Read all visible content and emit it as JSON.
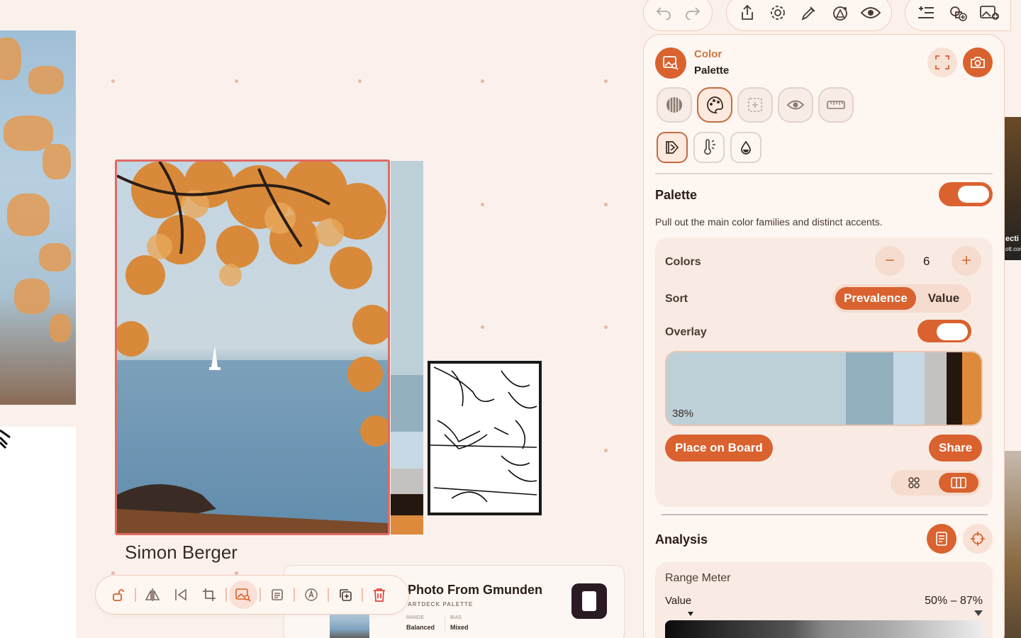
{
  "canvas": {
    "photo_caption": "Simon Berger",
    "card": {
      "title": "Photo From Gmunden",
      "subtitle": "ARTDECK PALETTE",
      "range_label": "RANGE",
      "range_value": "Balanced",
      "bias_label": "BIAS",
      "bias_value": "Mixed"
    },
    "palette_strip_colors": [
      "#bdd0d8",
      "#93b0be",
      "#c6d9e4",
      "#c4c2c1",
      "#24170f",
      "#dd8a3c"
    ],
    "right_edge_text": [
      "ecti",
      "ott.cor"
    ],
    "bottom_toolbar_icons": [
      "unlock-icon",
      "flip-icon",
      "align-icon",
      "crop-icon",
      "image-search-icon",
      "notes-icon",
      "edit-icon",
      "duplicate-icon",
      "trash-icon"
    ]
  },
  "top_toolbar": {
    "group1": [
      "undo-icon",
      "redo-icon"
    ],
    "group2": [
      "share-icon",
      "gear-icon",
      "eyedropper-icon",
      "shapes-icon",
      "eye-icon"
    ],
    "group3": [
      "list-add-icon",
      "group-add-icon",
      "image-add-icon"
    ]
  },
  "panel": {
    "header": {
      "title_line1": "Color",
      "title_line2": "Palette"
    },
    "modes": [
      "halftone-icon",
      "palette-icon",
      "focus-icon",
      "eye-icon",
      "ruler-icon"
    ],
    "submodes": [
      "marker-icon",
      "temperature-icon",
      "drop-icon"
    ],
    "palette": {
      "title": "Palette",
      "enabled": true,
      "description": "Pull out the main color families and distinct accents.",
      "colors_label": "Colors",
      "colors_value": "6",
      "minus": "−",
      "plus": "+",
      "sort_label": "Sort",
      "sort_options": [
        "Prevalence",
        "Value"
      ],
      "sort_selected": "Prevalence",
      "overlay_label": "Overlay",
      "overlay_enabled": true,
      "swatches": [
        {
          "color": "#bdd0d8",
          "share": 0.57
        },
        {
          "color": "#93b0be",
          "share": 0.15
        },
        {
          "color": "#c6d9e4",
          "share": 0.1
        },
        {
          "color": "#c4c2c1",
          "share": 0.07
        },
        {
          "color": "#24170f",
          "share": 0.05
        },
        {
          "color": "#dd8a3c",
          "share": 0.06
        }
      ],
      "top_share_label": "38%",
      "place_label": "Place on Board",
      "share_label": "Share"
    },
    "analysis": {
      "title": "Analysis",
      "range_meter_title": "Range Meter",
      "value_label": "Value",
      "value_range": "50% – 87%"
    }
  }
}
